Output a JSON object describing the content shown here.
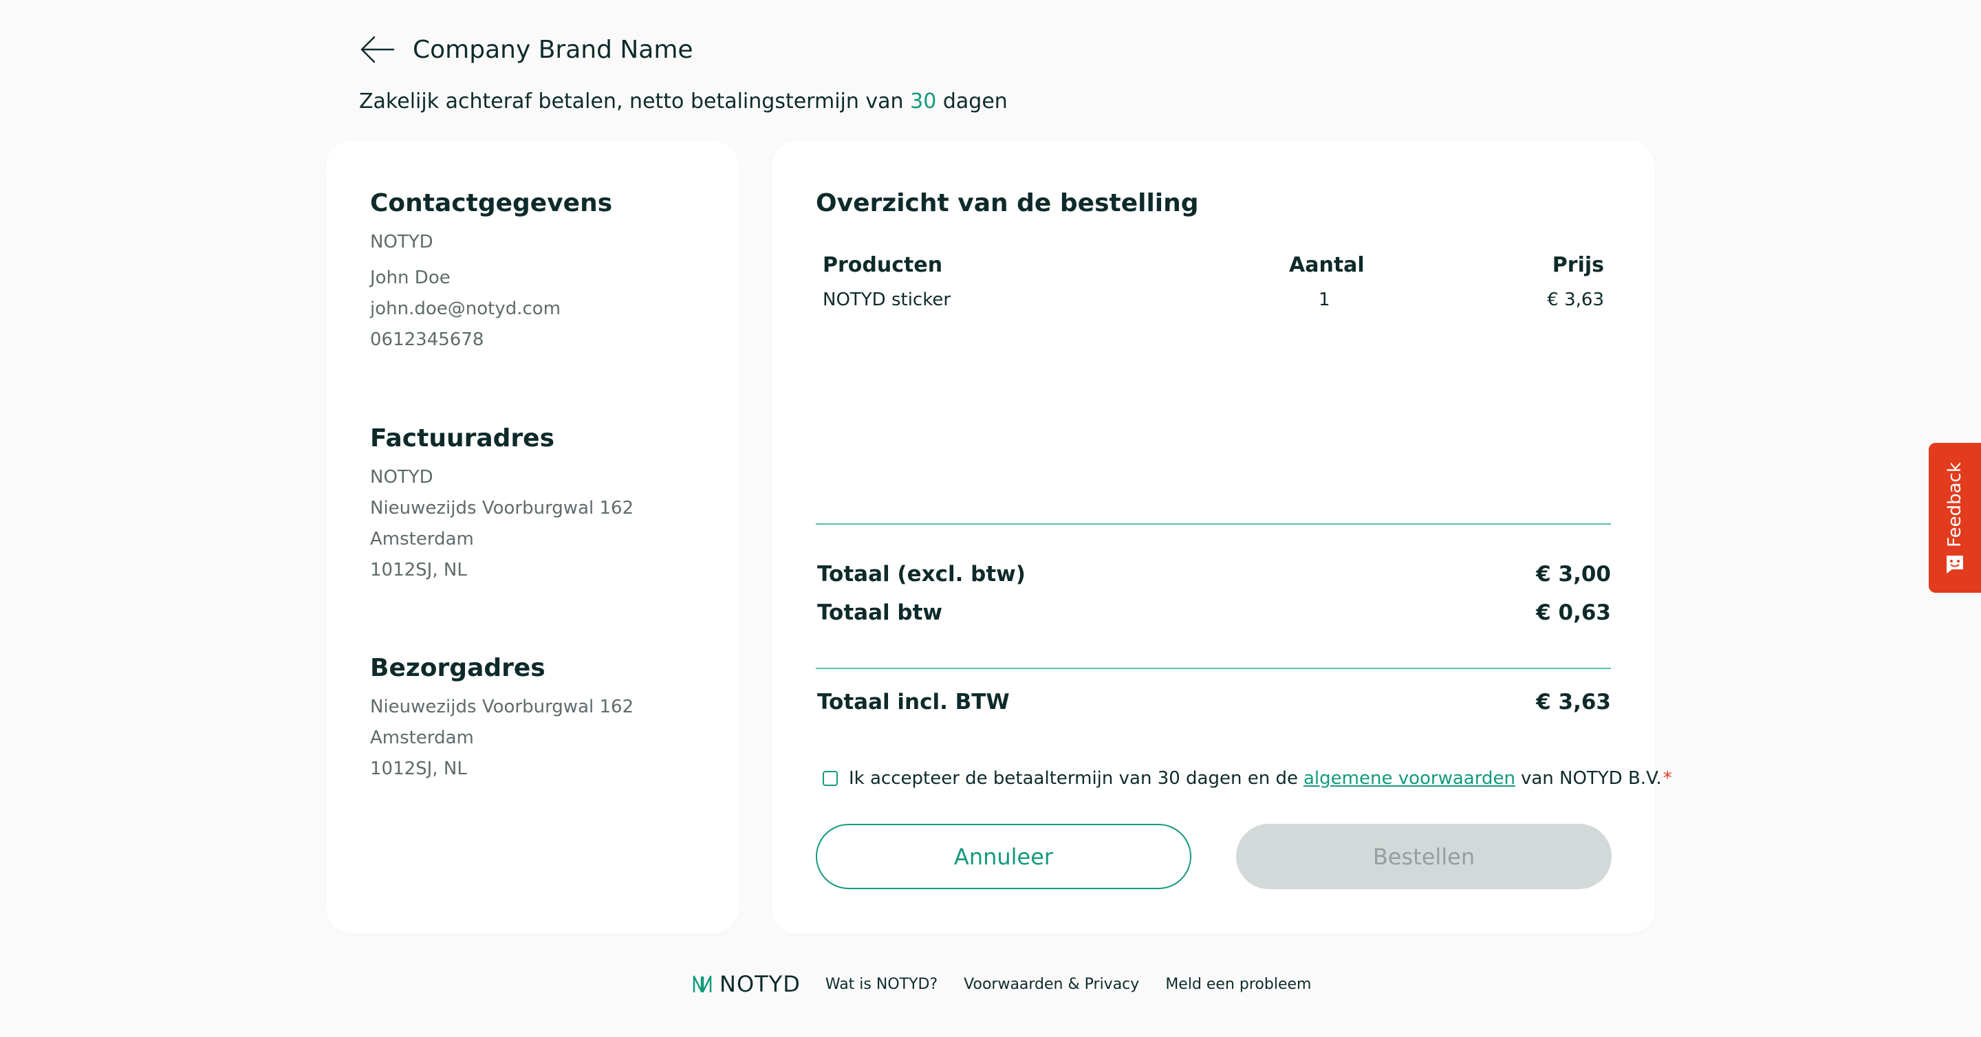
{
  "header": {
    "brand_name": "Company Brand Name",
    "subtitle_prefix": "Zakelijk achteraf betalen, netto betalingstermijn van",
    "subtitle_days": "30",
    "subtitle_suffix": "dagen"
  },
  "contact": {
    "title": "Contactgegevens",
    "company": "NOTYD",
    "name": "John Doe",
    "email": "john.doe@notyd.com",
    "phone": "0612345678"
  },
  "billing": {
    "title": "Factuuradres",
    "company": "NOTYD",
    "street": "Nieuwezijds Voorburgwal 162",
    "city": "Amsterdam",
    "postal": "1012SJ, NL"
  },
  "delivery": {
    "title": "Bezorgadres",
    "street": "Nieuwezijds Voorburgwal 162",
    "city": "Amsterdam",
    "postal": "1012SJ, NL"
  },
  "order": {
    "title": "Overzicht van de bestelling",
    "columns": {
      "product": "Producten",
      "quantity": "Aantal",
      "price": "Prijs"
    },
    "items": [
      {
        "product": "NOTYD sticker",
        "quantity": "1",
        "price": "€ 3,63"
      }
    ],
    "totals": {
      "excl_label": "Totaal (excl. btw)",
      "excl_value": "€ 3,00",
      "vat_label": "Totaal btw",
      "vat_value": "€ 0,63",
      "incl_label": "Totaal incl. BTW",
      "incl_value": "€ 3,63"
    },
    "terms": {
      "prefix": "Ik accepteer de betaaltermijn van 30 dagen en de",
      "link": "algemene voorwaarden",
      "suffix": "van NOTYD B.V.",
      "required": "*",
      "checked": false
    },
    "buttons": {
      "cancel": "Annuleer",
      "order": "Bestellen"
    }
  },
  "feedback": {
    "label": "Feedback"
  },
  "footer": {
    "logo_text": "NOTYD",
    "links": [
      "Wat is NOTYD?",
      "Voorwaarden & Privacy",
      "Meld een probleem"
    ]
  },
  "colors": {
    "accent": "#139a7d",
    "feedback": "#e23b1d",
    "disabled": "#d3d9d8"
  }
}
